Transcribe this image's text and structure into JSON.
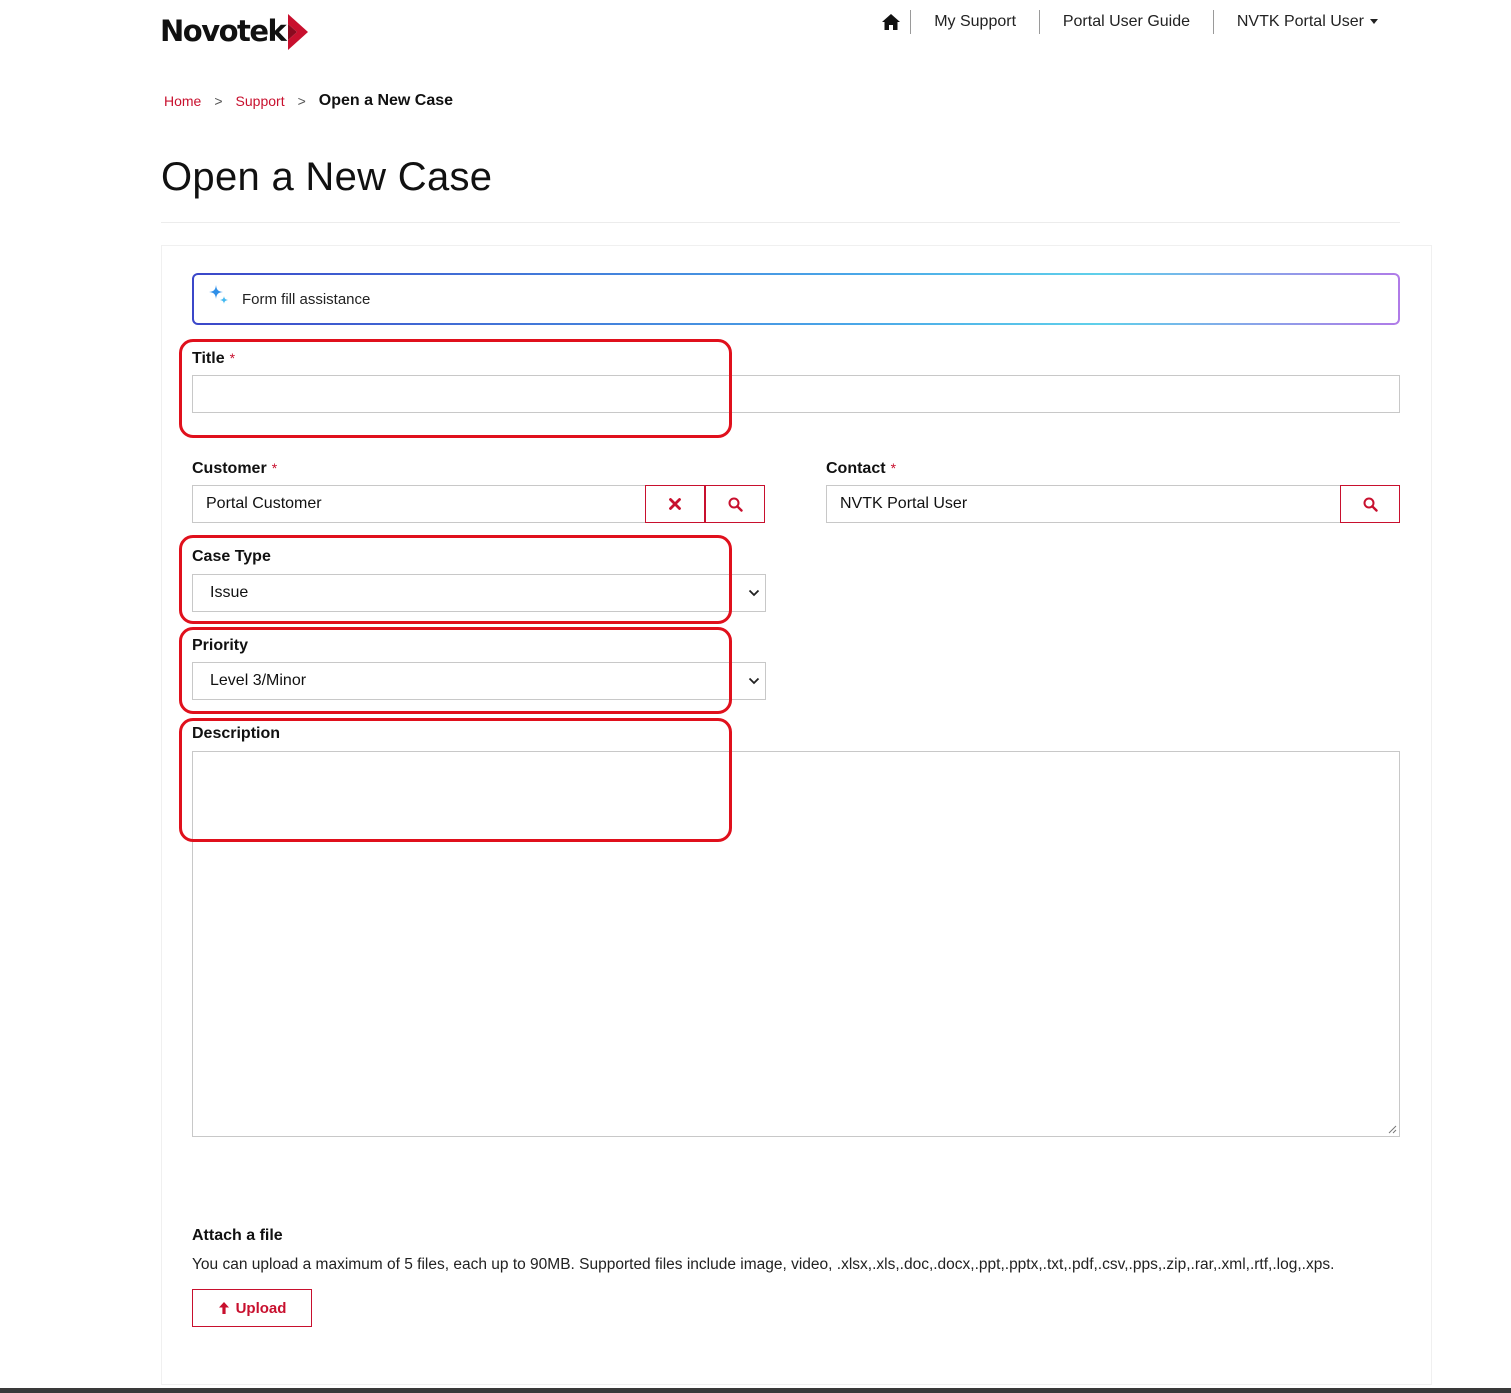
{
  "header": {
    "logo_text": "Novotek",
    "nav": {
      "my_support": "My Support",
      "guide": "Portal User Guide",
      "user": "NVTK Portal User"
    }
  },
  "breadcrumb": {
    "home": "Home",
    "support": "Support",
    "current": "Open a New Case",
    "separator": ">"
  },
  "page_title": "Open a New Case",
  "assist": {
    "label": "Form fill assistance"
  },
  "form": {
    "required_mark": "*",
    "title": {
      "label": "Title",
      "value": ""
    },
    "customer": {
      "label": "Customer",
      "value": "Portal Customer"
    },
    "contact": {
      "label": "Contact",
      "value": "NVTK Portal User"
    },
    "case_type": {
      "label": "Case Type",
      "value": "Issue"
    },
    "priority": {
      "label": "Priority",
      "value": "Level 3/Minor"
    },
    "description": {
      "label": "Description",
      "value": ""
    }
  },
  "attach": {
    "title": "Attach a file",
    "note": "You can upload a maximum of 5 files, each up to 90MB. Supported files include image, video, .xlsx,.xls,.doc,.docx,.ppt,.pptx,.txt,.pdf,.csv,.pps,.zip,.rar,.xml,.rtf,.log,.xps.",
    "upload_label": "Upload"
  },
  "colors": {
    "brand_red": "#c8102e",
    "highlight_red": "#e0101c",
    "assist_gradient_start": "#3b47c9",
    "assist_gradient_end": "#b07be8"
  },
  "icons": {
    "home": "home-icon",
    "close": "close-icon",
    "search": "search-icon",
    "chevron": "chevron-down-icon",
    "sparkle": "sparkle-icon",
    "upload": "upload-arrow-icon"
  }
}
